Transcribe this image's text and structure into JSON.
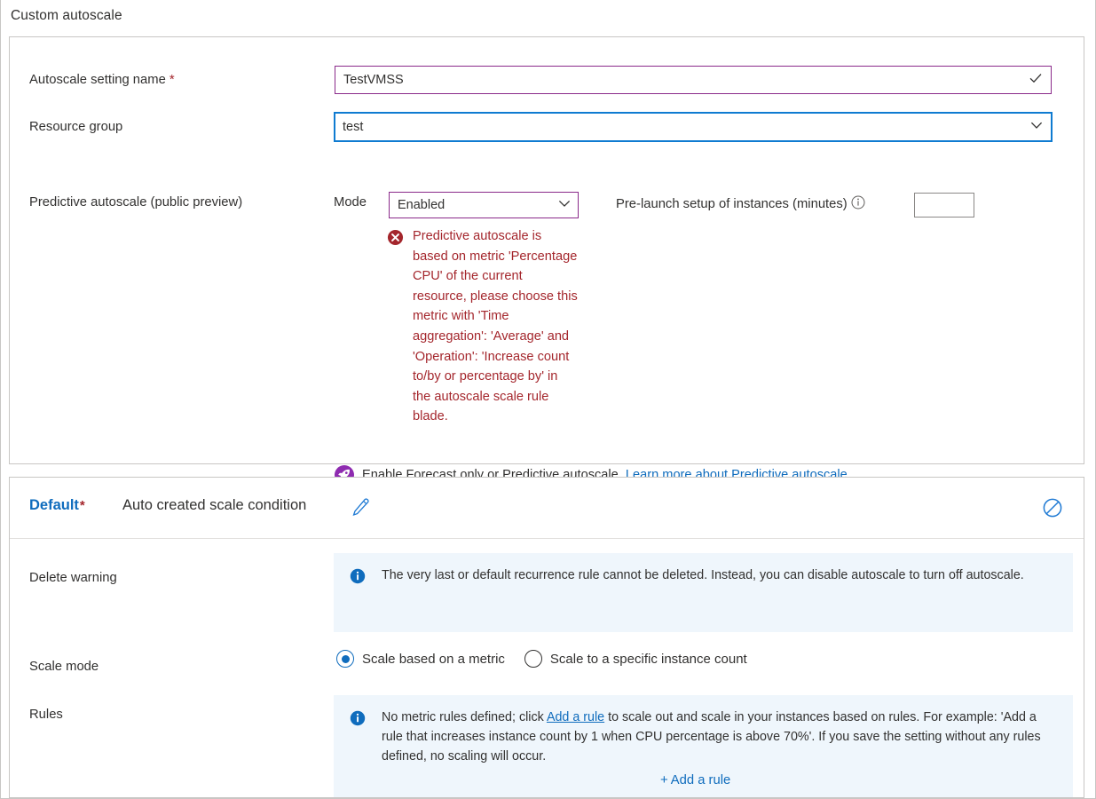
{
  "page": {
    "title": "Custom autoscale"
  },
  "settings": {
    "name_label": "Autoscale setting name",
    "name_required": "*",
    "name_value": "TestVMSS",
    "name_valid_icon": "check-icon",
    "resource_group_label": "Resource group",
    "resource_group_value": "test",
    "predictive_label": "Predictive autoscale (public preview)",
    "mode_label": "Mode",
    "mode_value": "Enabled",
    "mode_options": [
      "Enabled"
    ],
    "prelaunch_label": "Pre-launch setup of instances (minutes)",
    "prelaunch_info_icon": "info-icon",
    "prelaunch_value": "",
    "error_icon": "error-icon",
    "error_text": "Predictive autoscale is based on metric 'Percentage CPU' of the current resource, please choose this metric with 'Time aggregation': 'Average' and 'Operation': 'Increase count to/by or percentage by' in the autoscale scale rule blade.",
    "enable_icon": "rocket-icon",
    "enable_text": "Enable Forecast only or Predictive autoscale.",
    "enable_link": "Learn more about Predictive autoscale."
  },
  "condition": {
    "default_label": "Default",
    "default_required": "*",
    "name": "Auto created scale condition",
    "edit_icon": "pencil-icon",
    "disable_icon": "disable-icon",
    "delete_warning_label": "Delete warning",
    "delete_warning_icon": "info-icon",
    "delete_warning_text": "The very last or default recurrence rule cannot be deleted. Instead, you can disable autoscale to turn off autoscale.",
    "scale_mode_label": "Scale mode",
    "scale_mode_options": [
      {
        "label": "Scale based on a metric",
        "selected": true
      },
      {
        "label": "Scale to a specific instance count",
        "selected": false
      }
    ],
    "rules_label": "Rules",
    "rules_icon": "info-icon",
    "rules_text_1": "No metric rules defined; click ",
    "rules_link": "Add a rule",
    "rules_text_2": " to scale out and scale in your instances based on rules. For example: 'Add a rule that increases instance count by 1 when CPU percentage is above 70%'. If you save the setting without any rules defined, no scaling will occur.",
    "add_rule_plus": "+",
    "add_rule_label": "Add a rule"
  },
  "colors": {
    "accent_blue": "#0f6cbd",
    "field_purple": "#8a2a8a",
    "focus_blue": "#0f7bd1",
    "error_red": "#a4262c",
    "info_bg": "#eff6fc",
    "rocket_purple": "#8e2bb0"
  }
}
